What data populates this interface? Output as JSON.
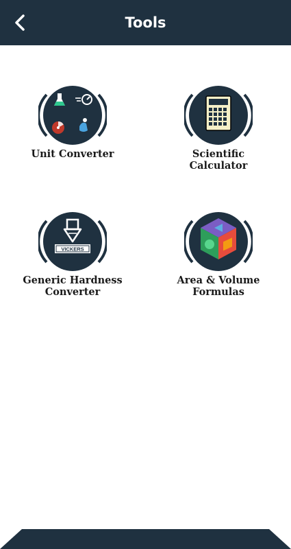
{
  "header": {
    "title": "Tools",
    "back_icon": "chevron-left-icon",
    "background": "#1f3140"
  },
  "tools": [
    {
      "line1": "Unit Converter",
      "line2": "",
      "icon": "unit-converter-icon"
    },
    {
      "line1": "Scientific",
      "line2": "Calculator",
      "icon": "calculator-icon"
    },
    {
      "line1": "Generic Hardness",
      "line2": "Converter",
      "icon": "vickers-hardness-icon",
      "badge": "VICKERS"
    },
    {
      "line1": "Area & Volume",
      "line2": "Formulas",
      "icon": "geometric-shapes-icon"
    }
  ],
  "colors": {
    "icon_circle": "#1f3140",
    "text": "#1a1a1a",
    "footer": "#1f3140"
  }
}
